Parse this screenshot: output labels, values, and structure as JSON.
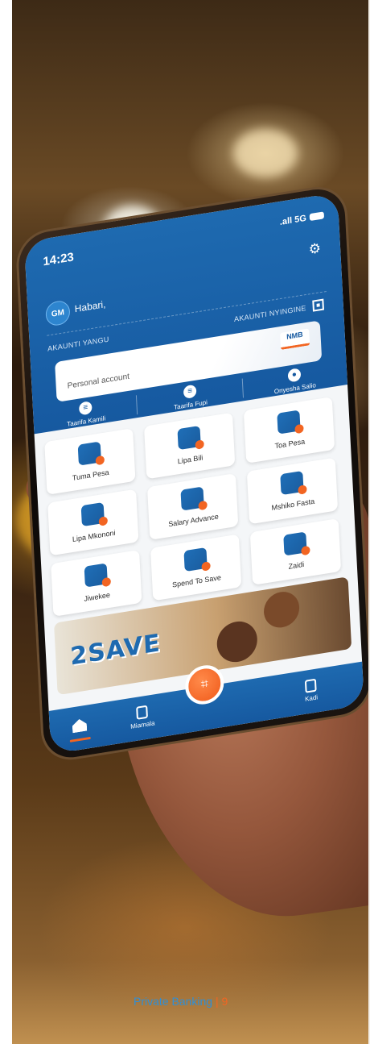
{
  "status_bar": {
    "time": "14:23",
    "network": ".all 5G"
  },
  "user": {
    "initials": "GM",
    "greeting": "Habari,"
  },
  "account": {
    "section_label": "AKAUNTI YANGU",
    "other_accounts_label": "AKAUNTI NYINGINE",
    "card_name": "Personal account",
    "bank_logo": "NMB"
  },
  "quick_actions": [
    {
      "label": "Taarifa Kamili",
      "icon": "statement-icon"
    },
    {
      "label": "Taarifa Fupi",
      "icon": "mini-statement-icon"
    },
    {
      "label": "Onyesha Salio",
      "icon": "eye-icon"
    }
  ],
  "services": [
    {
      "label": "Tuma Pesa",
      "icon": "send-money-icon"
    },
    {
      "label": "Lipa Bili",
      "icon": "pay-bill-icon"
    },
    {
      "label": "Toa Pesa",
      "icon": "withdraw-icon"
    },
    {
      "label": "Lipa Mkononi",
      "icon": "qr-pay-icon"
    },
    {
      "label": "Salary Advance",
      "icon": "salary-advance-icon"
    },
    {
      "label": "Mshiko Fasta",
      "icon": "loan-icon"
    },
    {
      "label": "Jiwekee",
      "icon": "savings-bag-icon"
    },
    {
      "label": "Spend To Save",
      "icon": "spend-to-save-icon"
    },
    {
      "label": "Zaidi",
      "icon": "more-icon"
    }
  ],
  "banner": {
    "title": "2SAVE"
  },
  "bottom_nav": [
    {
      "label": "",
      "icon": "home-icon"
    },
    {
      "label": "Miamala",
      "icon": "transactions-icon"
    },
    {
      "label": "Kadi",
      "icon": "card-icon"
    }
  ],
  "footer": {
    "text": "Private Banking",
    "separator": "|",
    "page_number": "9"
  },
  "colors": {
    "brand_blue": "#1659a0",
    "accent_orange": "#f26522",
    "footer_text": "#2f8fd6"
  }
}
